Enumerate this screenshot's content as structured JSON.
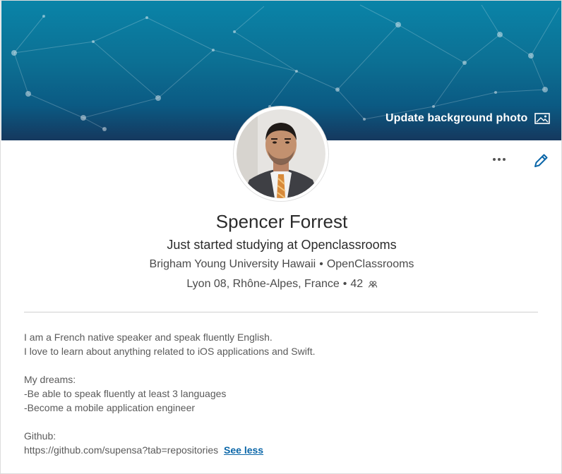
{
  "banner": {
    "update_label": "Update background photo",
    "update_icon": "image-icon"
  },
  "profile": {
    "name": "Spencer Forrest",
    "headline": "Just started studying at Openclassrooms",
    "education": [
      "Brigham Young University Hawaii",
      "OpenClassrooms"
    ],
    "location": "Lyon 08, Rhône-Alpes, France",
    "connections": "42",
    "separator": "•"
  },
  "actions": {
    "more_icon": "ellipsis-icon",
    "edit_icon": "pencil-icon"
  },
  "about": {
    "lines": [
      "I am a French native speaker and speak fluently English.",
      "I love to learn about anything related to iOS applications and Swift.",
      "",
      "My dreams:",
      "-Be able to speak fluently at least 3 languages",
      "-Become a mobile application engineer",
      "",
      "Github:"
    ],
    "github_url": "https://github.com/supensa?tab=repositories",
    "see_less_label": "See less"
  },
  "colors": {
    "banner_top": "#0a84a8",
    "banner_bottom": "#15385e",
    "link": "#0a66a8",
    "edit_icon": "#0a66a8"
  }
}
